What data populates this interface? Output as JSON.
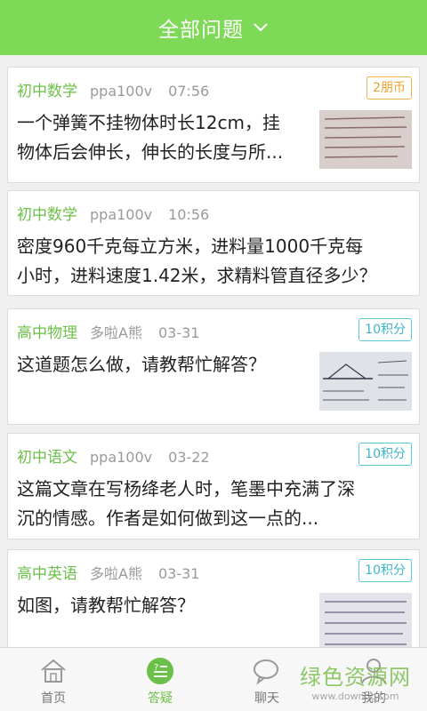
{
  "header": {
    "title": "全部问题"
  },
  "questions": [
    {
      "subject": "初中数学",
      "user": "ppa100v",
      "time": "07:56",
      "reward": "2朋币",
      "line1": "一个弹簧不挂物体时长12cm，挂",
      "line2": "物体后会伸长，伸长的长度与所..."
    },
    {
      "subject": "初中数学",
      "user": "ppa100v",
      "time": "10:56",
      "reward": "",
      "line1": "密度960千克每立方米，进料量1000千克每",
      "line2": "小时，进料速度1.42米，求精料管直径多少？"
    },
    {
      "subject": "高中物理",
      "user": "多啦A熊",
      "time": "03-31",
      "reward": "10积分",
      "line1": "这道题怎么做，请教帮忙解答？",
      "line2": ""
    },
    {
      "subject": "初中语文",
      "user": "ppa100v",
      "time": "03-22",
      "reward": "10积分",
      "line1": "这篇文章在写杨绛老人时，笔墨中充满了深",
      "line2": "沉的情感。作者是如何做到这一点的..."
    },
    {
      "subject": "高中英语",
      "user": "多啦A熊",
      "time": "03-31",
      "reward": "10积分",
      "line1": "如图，请教帮忙解答？",
      "line2": ""
    }
  ],
  "tabs": [
    {
      "label": "首页",
      "icon": "home-icon"
    },
    {
      "label": "答疑",
      "icon": "qa-icon"
    },
    {
      "label": "聊天",
      "icon": "chat-icon"
    },
    {
      "label": "我的",
      "icon": "user-icon"
    }
  ],
  "watermark": {
    "text": "绿色资源网",
    "url": "www.downcc.com"
  },
  "colors": {
    "accent": "#7ed957",
    "subject": "#6cc04a",
    "badge_orange": "#f0a030",
    "badge_cyan": "#3bb6c6"
  }
}
